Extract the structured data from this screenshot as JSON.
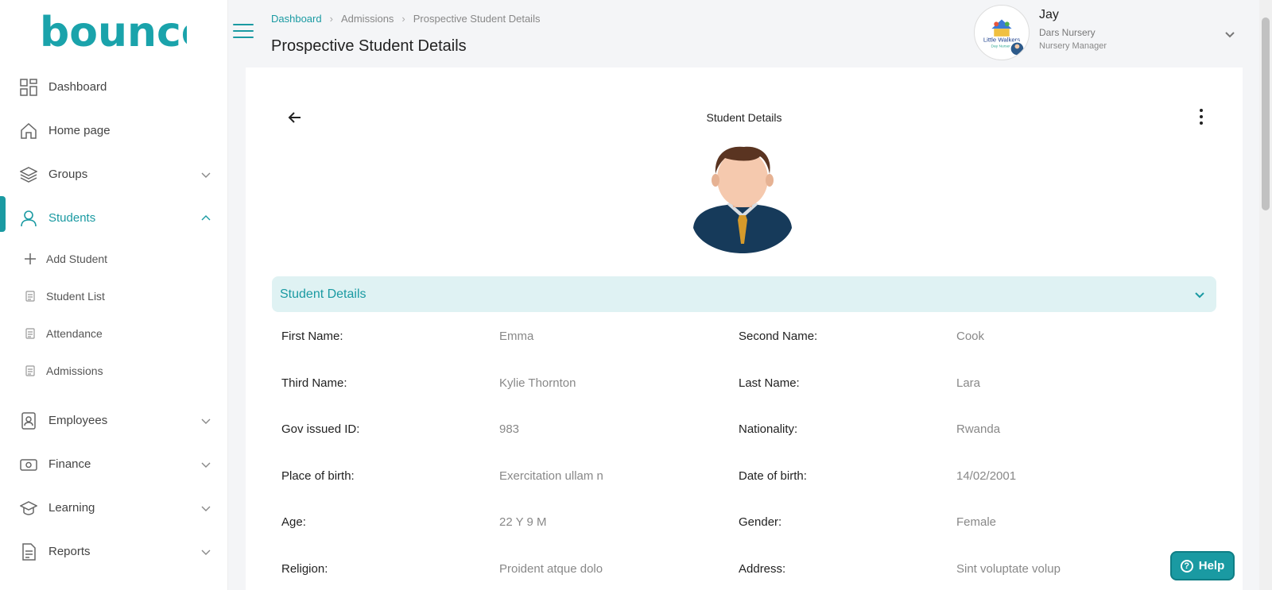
{
  "brand": {
    "logo_text": "bounce",
    "accent": "#1a9aa2"
  },
  "sidebar": {
    "items": [
      {
        "label": "Dashboard",
        "icon": "dashboard-icon"
      },
      {
        "label": "Home page",
        "icon": "home-icon"
      },
      {
        "label": "Groups",
        "icon": "layers-icon",
        "expandable": true
      },
      {
        "label": "Students",
        "icon": "user-icon",
        "expandable": true,
        "active": true
      },
      {
        "label": "Employees",
        "icon": "id-badge-icon",
        "expandable": true
      },
      {
        "label": "Finance",
        "icon": "money-icon",
        "expandable": true
      },
      {
        "label": "Learning",
        "icon": "graduation-cap-icon",
        "expandable": true
      },
      {
        "label": "Reports",
        "icon": "document-icon",
        "expandable": true
      }
    ],
    "student_subitems": [
      {
        "label": "Add Student",
        "icon": "plus-icon"
      },
      {
        "label": "Student List",
        "icon": "clipboard-icon"
      },
      {
        "label": "Attendance",
        "icon": "clipboard-icon"
      },
      {
        "label": "Admissions",
        "icon": "clipboard-icon"
      }
    ]
  },
  "header": {
    "breadcrumb": [
      "Dashboard",
      "Admissions",
      "Prospective Student Details"
    ],
    "title": "Prospective Student Details"
  },
  "profile": {
    "name": "Jay",
    "org": "Dars Nursery",
    "role": "Nursery Manager",
    "logo_text": "Little Walkers",
    "logo_subtext": "Day Nursery"
  },
  "card": {
    "title": "Student Details",
    "section_title": "Student Details"
  },
  "fields": [
    [
      {
        "label": "First Name:",
        "value": "Emma"
      },
      {
        "label": "Second Name:",
        "value": "Cook"
      }
    ],
    [
      {
        "label": "Third Name:",
        "value": "Kylie Thornton"
      },
      {
        "label": "Last Name:",
        "value": "Lara"
      }
    ],
    [
      {
        "label": "Gov issued ID:",
        "value": "983"
      },
      {
        "label": "Nationality:",
        "value": "Rwanda"
      }
    ],
    [
      {
        "label": "Place of birth:",
        "value": "Exercitation ullam n"
      },
      {
        "label": "Date of birth:",
        "value": "14/02/2001"
      }
    ],
    [
      {
        "label": "Age:",
        "value": "22 Y 9 M"
      },
      {
        "label": "Gender:",
        "value": "Female"
      }
    ],
    [
      {
        "label": "Religion:",
        "value": "Proident atque dolo"
      },
      {
        "label": "Address:",
        "value": "Sint voluptate volup"
      }
    ]
  ],
  "help": {
    "label": "Help"
  }
}
